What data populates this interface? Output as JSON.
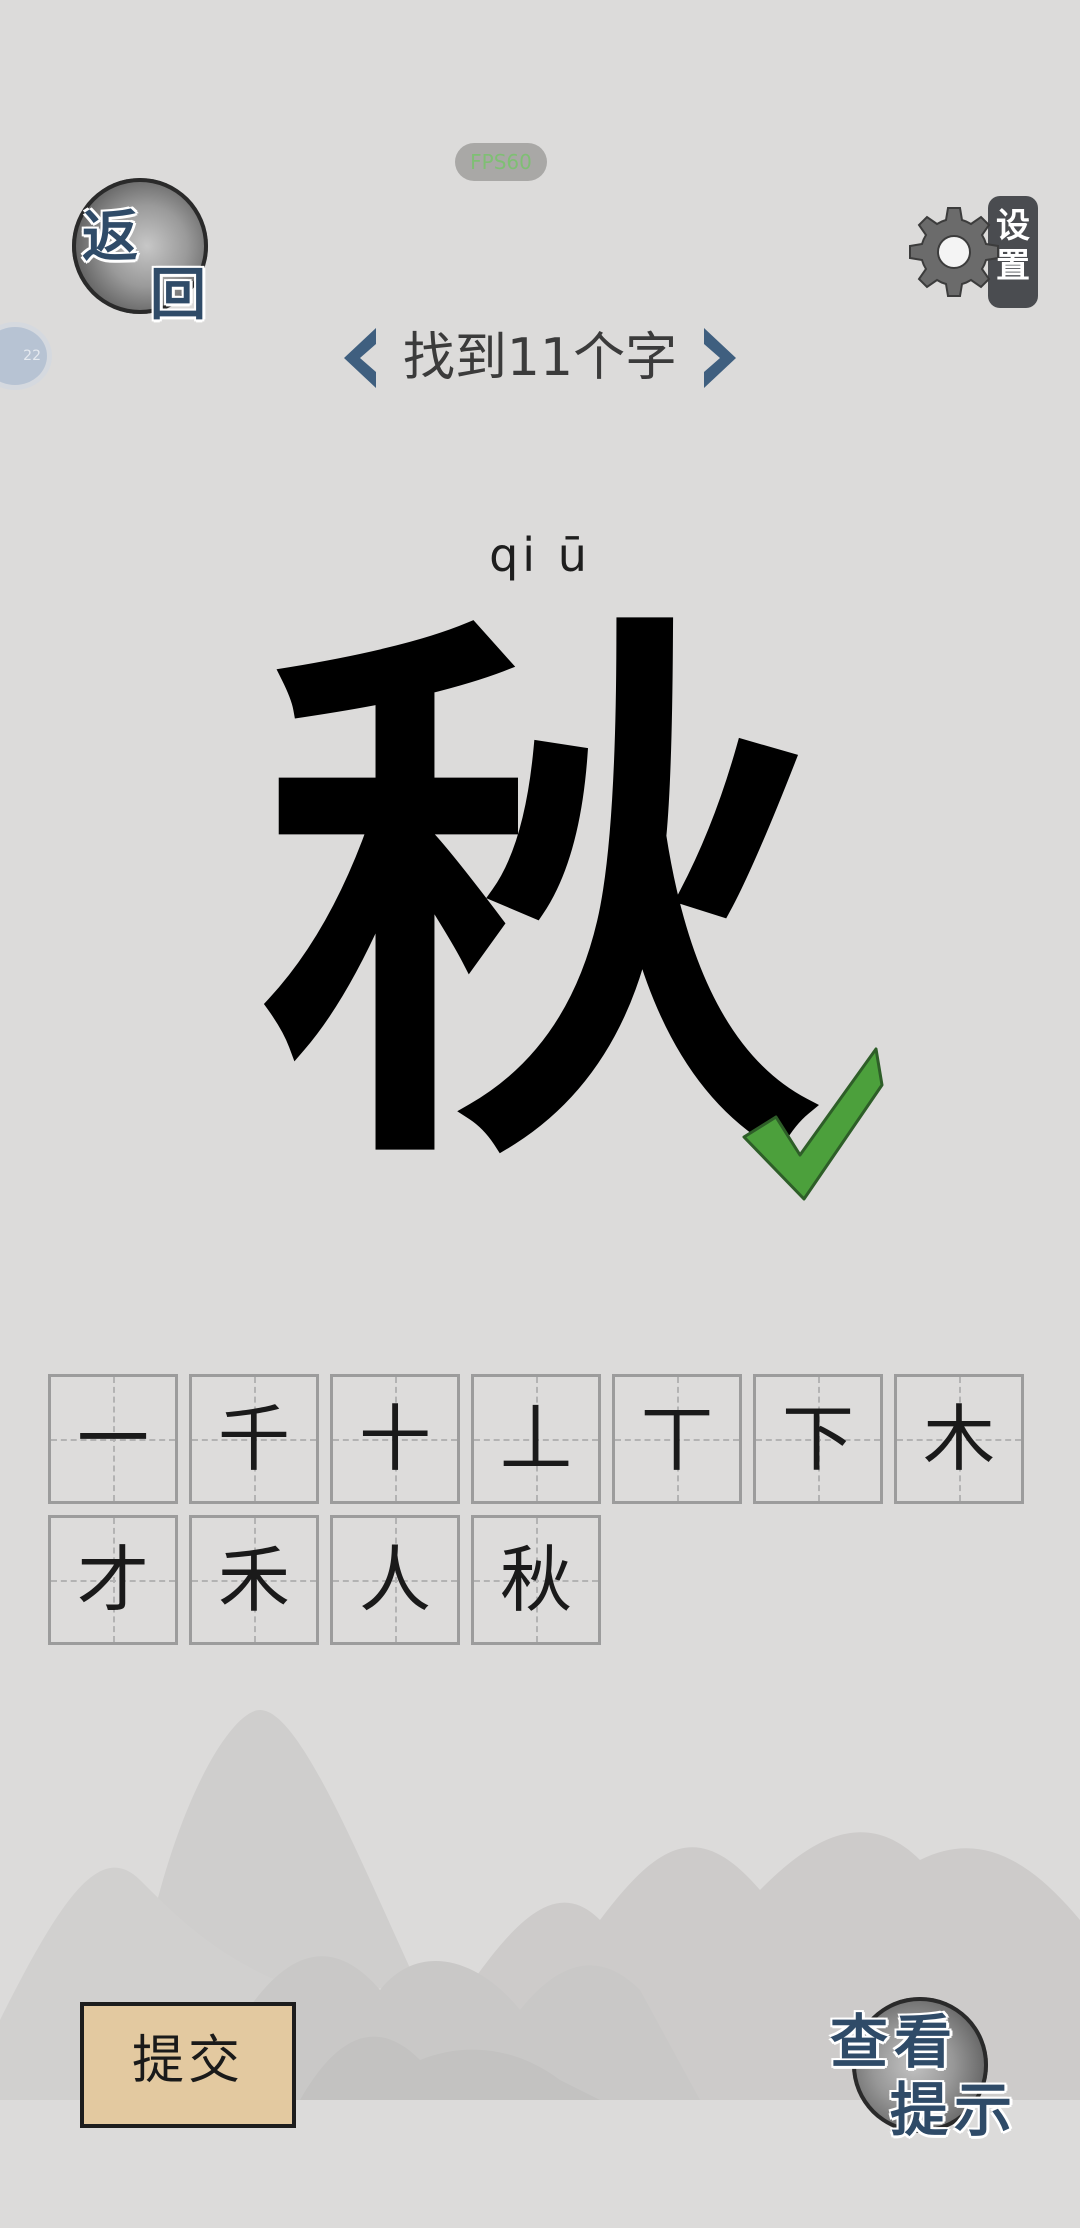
{
  "status": {
    "fps": "FPS60"
  },
  "back": {
    "label_1": "返",
    "label_2": "回"
  },
  "side_badge": {
    "text": "22"
  },
  "settings": {
    "label": "设置"
  },
  "title": {
    "text": "找到11个字"
  },
  "puzzle": {
    "pinyin": "qi ū",
    "character": "秋",
    "solved": true
  },
  "found_characters": [
    "一",
    "千",
    "十",
    "丄",
    "丅",
    "下",
    "木",
    "才",
    "禾",
    "人",
    "秋"
  ],
  "buttons": {
    "submit": "提交",
    "hint_1": "查看",
    "hint_2": "提示"
  },
  "colors": {
    "background": "#dcdbda",
    "accent_blue": "#3f5f7f",
    "check_green": "#4ca03c",
    "submit_bg": "#e3c9a0"
  }
}
